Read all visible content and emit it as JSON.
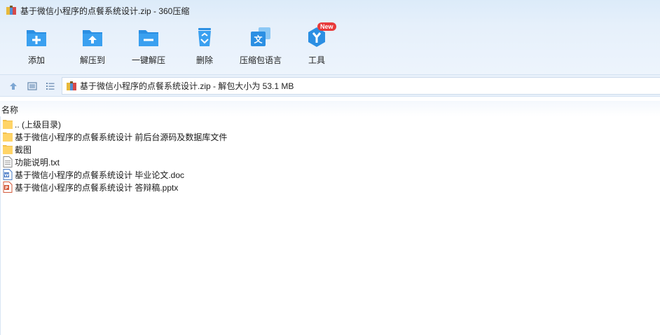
{
  "window": {
    "title": "基于微信小程序的点餐系统设计.zip - 360压缩"
  },
  "toolbar": {
    "items": [
      {
        "label": "添加",
        "icon": "add-icon"
      },
      {
        "label": "解压到",
        "icon": "extract-to-icon"
      },
      {
        "label": "一键解压",
        "icon": "one-click-extract-icon"
      },
      {
        "label": "删除",
        "icon": "delete-icon"
      },
      {
        "label": "压缩包语言",
        "icon": "archive-language-icon"
      },
      {
        "label": "工具",
        "icon": "tools-icon",
        "badge": "New"
      }
    ]
  },
  "address": {
    "text": "基于微信小程序的点餐系统设计.zip - 解包大小为 53.1 MB"
  },
  "list": {
    "column_name": "名称",
    "rows": [
      {
        "name": ".. (上级目录)",
        "type": "folder"
      },
      {
        "name": "基于微信小程序的点餐系统设计 前后台源码及数据库文件",
        "type": "folder"
      },
      {
        "name": "截图",
        "type": "folder"
      },
      {
        "name": "功能说明.txt",
        "type": "txt"
      },
      {
        "name": "基于微信小程序的点餐系统设计 毕业论文.doc",
        "type": "doc"
      },
      {
        "name": "基于微信小程序的点餐系统设计 答辩稿.pptx",
        "type": "pptx"
      }
    ]
  },
  "colors": {
    "accent": "#2b8fe3",
    "folder": "#ffd467",
    "badge": "#e83a3a"
  }
}
